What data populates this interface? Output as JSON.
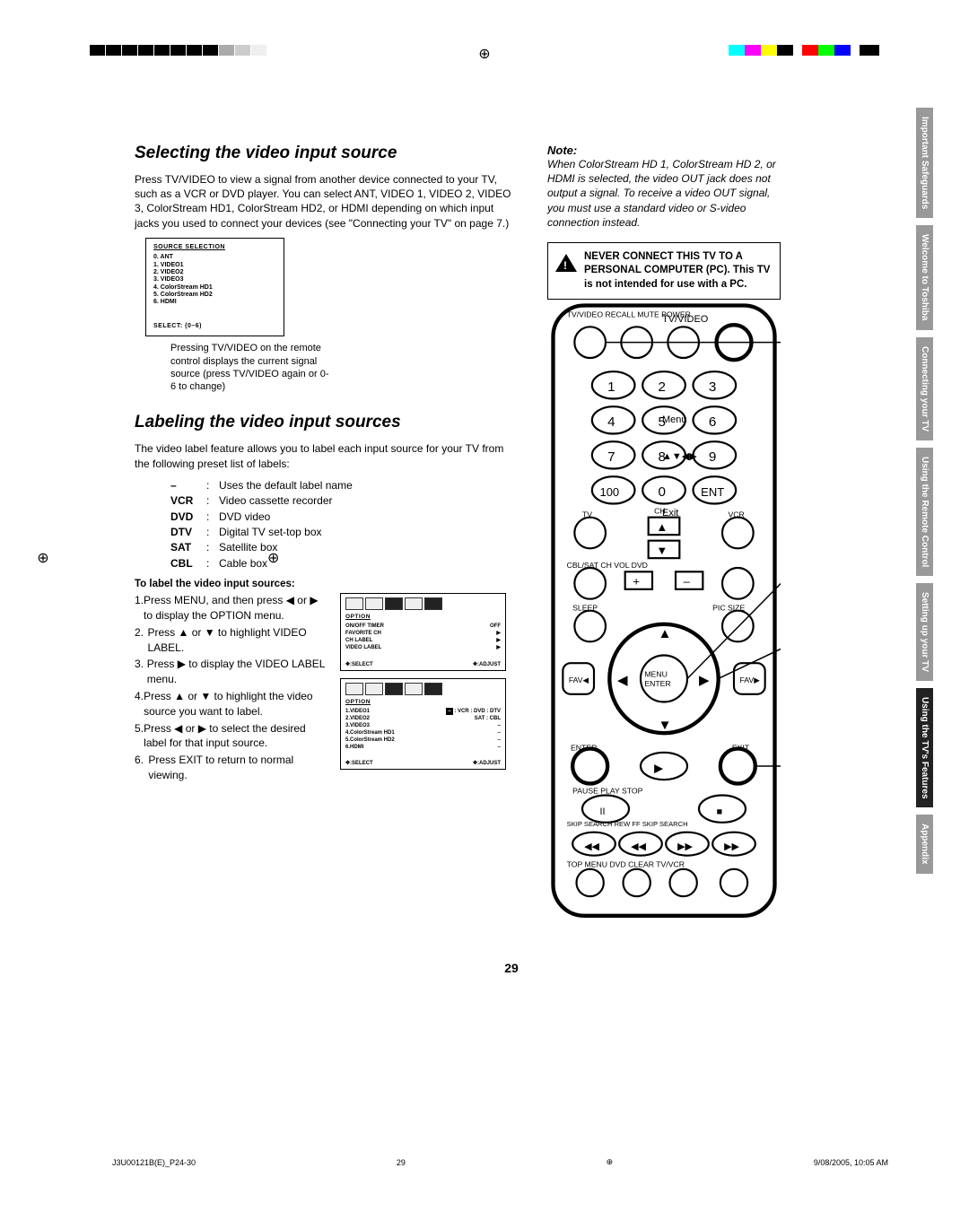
{
  "page_number": "29",
  "footer_left": "J3U00121B(E)_P24-30",
  "footer_mid": "29",
  "footer_right": "9/08/2005, 10:05 AM",
  "section1": {
    "title": "Selecting the video input source",
    "para": "Press TV/VIDEO to view a signal from another device connected to your TV, such as a VCR or DVD player. You can select ANT, VIDEO 1, VIDEO 2, VIDEO 3, ColorStream HD1, ColorStream HD2, or HDMI depending on which input jacks you used to connect your devices (see \"Connecting your TV\" on page 7.)",
    "osd_title": "SOURCE SELECTION",
    "osd_items": [
      "0. ANT",
      "1. VIDEO1",
      "2. VIDEO2",
      "3. VIDEO3",
      "4. ColorStream HD1",
      "5. ColorStream HD2",
      "6. HDMI"
    ],
    "osd_select": "SELECT: (0–6)",
    "caption": "Pressing TV/VIDEO on the remote control displays the current signal source (press TV/VIDEO again or 0-6 to change)"
  },
  "section2": {
    "title": "Labeling the video input sources",
    "para": "The video label feature allows you to label each input source for your TV from the following preset list of labels:",
    "labels": [
      {
        "k": "–",
        "v": "Uses the default label name"
      },
      {
        "k": "VCR",
        "v": "Video cassette recorder"
      },
      {
        "k": "DVD",
        "v": "DVD video"
      },
      {
        "k": "DTV",
        "v": "Digital TV set-top box"
      },
      {
        "k": "SAT",
        "v": "Satellite box"
      },
      {
        "k": "CBL",
        "v": "Cable box"
      }
    ],
    "sub": "To label the video input sources:",
    "steps": [
      "Press MENU, and then press ◀ or ▶ to display the OPTION menu.",
      "Press ▲ or ▼ to highlight VIDEO LABEL.",
      "Press ▶ to display the VIDEO LABEL menu.",
      "Press ▲ or ▼ to highlight the video source you want to label.",
      "Press ◀ or ▶ to select the desired label for that input source.",
      "Press EXIT to return to normal viewing."
    ],
    "osd1": {
      "title": "OPTION",
      "rows": [
        {
          "l": "ON/OFF TIMER",
          "r": "OFF"
        },
        {
          "l": "FAVORITE CH",
          "r": "▶"
        },
        {
          "l": "CH LABEL",
          "r": "▶"
        },
        {
          "l": "VIDEO LABEL",
          "r": "▶"
        }
      ],
      "foot_l": ":SELECT",
      "foot_r": ":ADJUST"
    },
    "osd2": {
      "title": "OPTION",
      "rows": [
        {
          "l": "1.VIDEO1",
          "r": "– : VCR : DVD : DTV"
        },
        {
          "l": "2.VIDEO2",
          "r": "SAT : CBL"
        },
        {
          "l": "3.VIDEO3",
          "r": "–"
        },
        {
          "l": "4.ColorStream  HD1",
          "r": "–"
        },
        {
          "l": "5.ColorStream  HD2",
          "r": "–"
        },
        {
          "l": "6.HDMI",
          "r": "–"
        }
      ],
      "foot_l": ":SELECT",
      "foot_r": ":ADJUST"
    }
  },
  "note": {
    "head": "Note:",
    "body": "When ColorStream HD 1, ColorStream HD 2, or HDMI is selected, the video OUT jack does not output a signal. To receive a video OUT signal, you must use a standard video or S-video connection instead."
  },
  "warn": {
    "l1": "NEVER CONNECT THIS TV TO A PERSONAL COMPUTER (PC).",
    "l2": "This TV is not intended for use with a PC."
  },
  "remote_labels": {
    "a": "TV/VIDEO",
    "b": "Menu",
    "c": "▲▼◀▶",
    "d": "Exit"
  },
  "tabs": [
    "Important Safeguards",
    "Welcome to Toshiba",
    "Connecting your TV",
    "Using the Remote Control",
    "Setting up your TV",
    "Using the TV's Features",
    "Appendix"
  ],
  "top_colors": [
    "#00ffff",
    "#ff00ff",
    "#ffff00",
    "#000000",
    "#ff0000",
    "#00ff00",
    "#0000ff"
  ]
}
